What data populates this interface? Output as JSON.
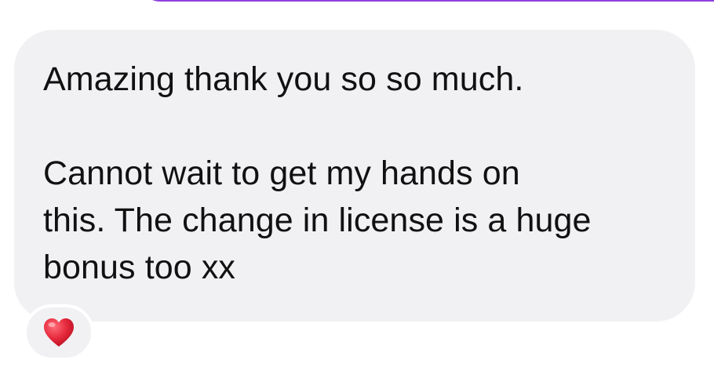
{
  "message": {
    "paragraph_1": "Amazing thank you so so much.",
    "paragraph_2_line_1": "Cannot wait to get my hands on",
    "paragraph_2_line_2": "this. The change in license is a huge",
    "paragraph_2_line_3": "bonus too xx"
  },
  "reaction": {
    "icon": "red-heart-icon",
    "color": "#e0233a"
  },
  "colors": {
    "bubble_background": "#f1f1f4",
    "text": "#111111",
    "top_bubble_accent": "#8e3fdc"
  }
}
